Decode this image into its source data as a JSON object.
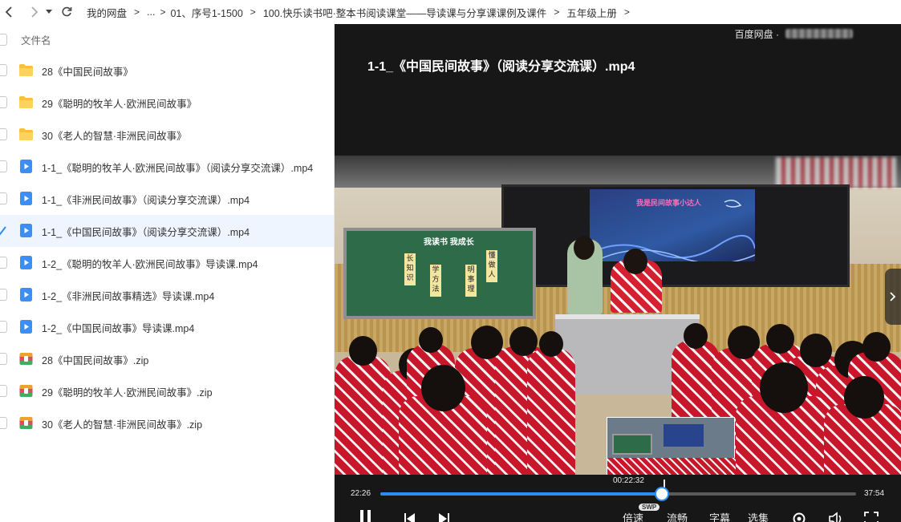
{
  "breadcrumb": [
    "我的网盘",
    "...",
    "01、序号1-1500",
    "100.快乐读书吧·整本书阅读课堂——导读课与分享课课例及课件",
    "五年级上册"
  ],
  "breadcrumb_sep": ">",
  "list": {
    "header": "文件名",
    "items": [
      {
        "name": "28《中国民间故事》",
        "type": "folder",
        "selected": false
      },
      {
        "name": "29《聪明的牧羊人·欧洲民间故事》",
        "type": "folder",
        "selected": false
      },
      {
        "name": "30《老人的智慧·非洲民间故事》",
        "type": "folder",
        "selected": false
      },
      {
        "name": "1-1_《聪明的牧羊人·欧洲民间故事》（阅读分享交流课）.mp4",
        "type": "video",
        "selected": false
      },
      {
        "name": "1-1_《非洲民间故事》（阅读分享交流课）.mp4",
        "type": "video",
        "selected": false
      },
      {
        "name": "1-1_《中国民间故事》（阅读分享交流课）.mp4",
        "type": "video",
        "selected": true
      },
      {
        "name": "1-2_《聪明的牧羊人·欧洲民间故事》导读课.mp4",
        "type": "video",
        "selected": false
      },
      {
        "name": "1-2_《非洲民间故事精选》导读课.mp4",
        "type": "video",
        "selected": false
      },
      {
        "name": "1-2_《中国民间故事》导读课.mp4",
        "type": "video",
        "selected": false
      },
      {
        "name": "28《中国民间故事》.zip",
        "type": "zip",
        "selected": false
      },
      {
        "name": "29《聪明的牧羊人·欧洲民间故事》.zip",
        "type": "zip",
        "selected": false
      },
      {
        "name": "30《老人的智慧·非洲民间故事》.zip",
        "type": "zip",
        "selected": false
      }
    ]
  },
  "player": {
    "brand": "百度网盘 ·",
    "title": "1-1_《中国民间故事》（阅读分享交流课）.mp4",
    "current_time": "22:26",
    "duration": "37:54",
    "hover_time": "00:22:32",
    "progress": 0.5918,
    "speed_label": "倍速",
    "speed_badge": "SWP",
    "quality_label": "流畅",
    "subtitle_label": "字幕",
    "episodes_label": "选集",
    "video_frame": {
      "board_title": "我读书 我成长",
      "board_cards": [
        "长知识",
        "学方法",
        "明事理",
        "懂做人"
      ],
      "slide_text": "我是民间故事小达人"
    }
  },
  "colors": {
    "accent": "#2b8cf4",
    "selected_row": "#eef5fe",
    "player_bg": "#171717"
  }
}
